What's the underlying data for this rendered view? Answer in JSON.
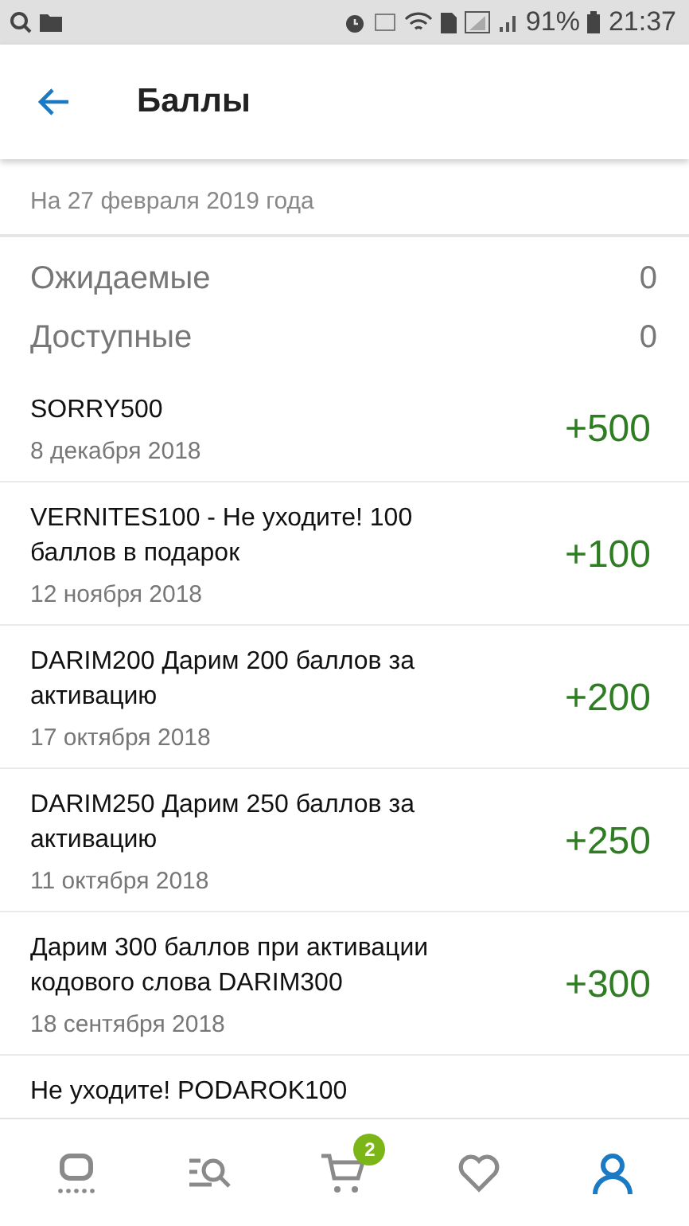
{
  "status_bar": {
    "battery": "91%",
    "time": "21:37"
  },
  "header": {
    "title": "Баллы"
  },
  "as_of": "На 27 февраля 2019 года",
  "summary": [
    {
      "label": "Ожидаемые",
      "value": "0"
    },
    {
      "label": "Доступные",
      "value": "0"
    }
  ],
  "transactions": [
    {
      "title": "SORRY500",
      "date": "8 декабря 2018",
      "amount": "+500"
    },
    {
      "title": "VERNITES100 - Не уходите! 100 баллов в подарок",
      "date": "12 ноября 2018",
      "amount": "+100"
    },
    {
      "title": "DARIM200 Дарим 200 баллов за активацию",
      "date": "17 октября 2018",
      "amount": "+200"
    },
    {
      "title": "DARIM250 Дарим 250 баллов за активацию",
      "date": "11 октября 2018",
      "amount": "+250"
    },
    {
      "title": "Дарим 300 баллов при активации кодового слова DARIM300",
      "date": "18 сентября 2018",
      "amount": "+300"
    },
    {
      "title": "Не уходите! PODAROK100"
    }
  ],
  "bottom_nav": [
    {
      "kind": "home",
      "selected": false
    },
    {
      "kind": "catalog",
      "selected": false
    },
    {
      "kind": "cart",
      "selected": false,
      "badge": "2"
    },
    {
      "kind": "favorites",
      "selected": false
    },
    {
      "kind": "profile",
      "selected": true
    }
  ]
}
